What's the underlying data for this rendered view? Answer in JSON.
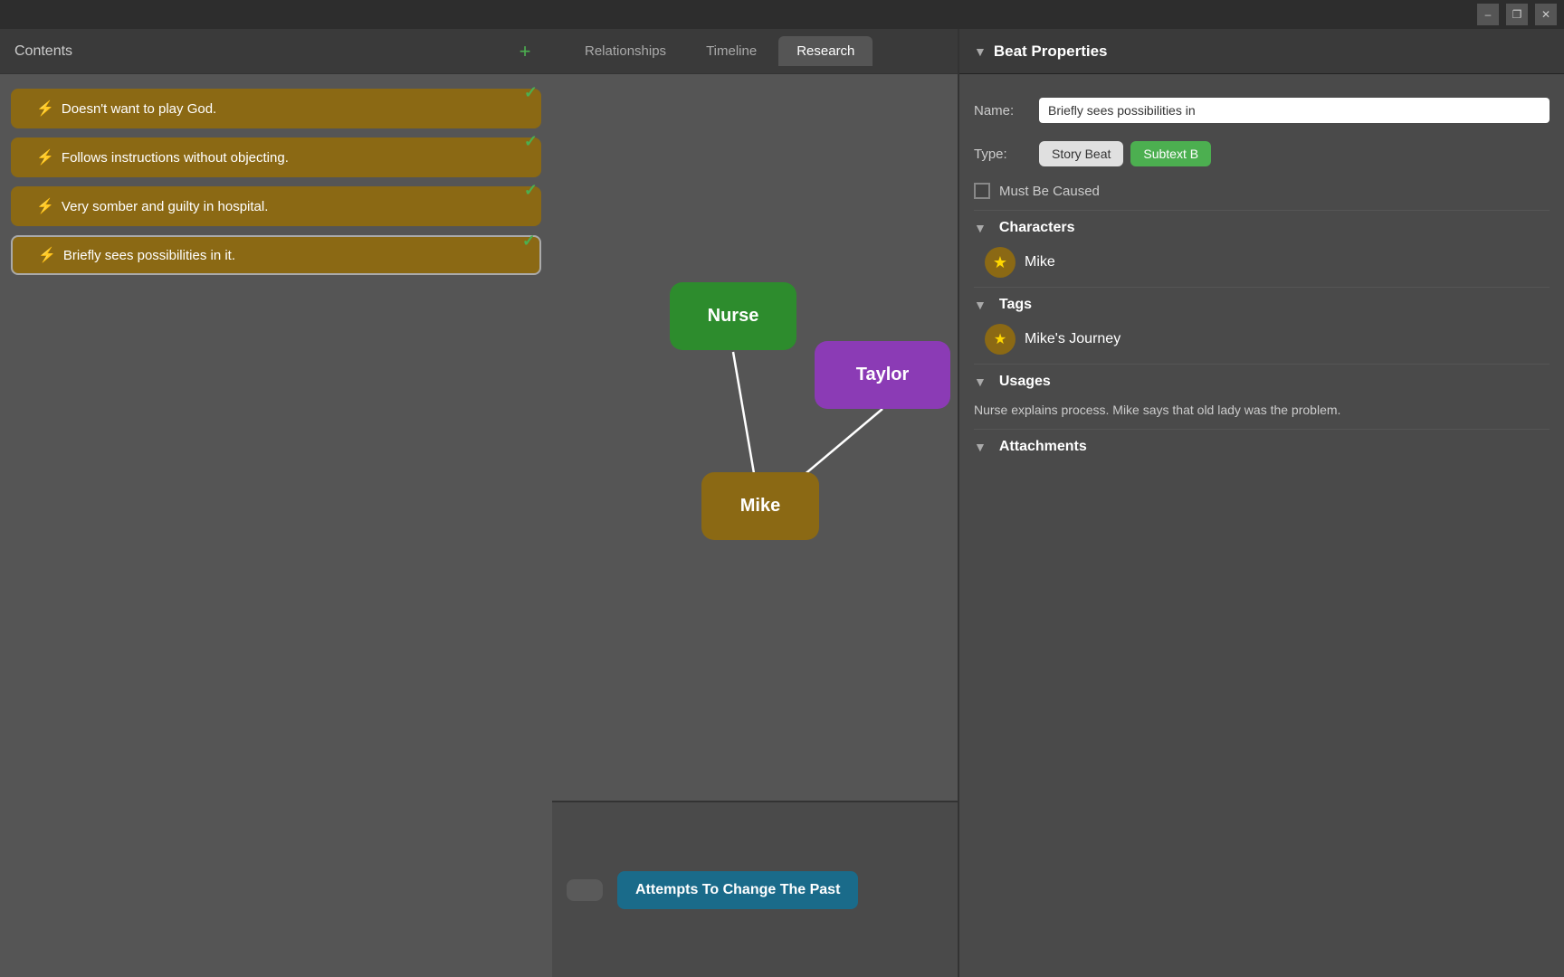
{
  "titlebar": {
    "minimize_label": "–",
    "restore_label": "❐",
    "close_label": "✕"
  },
  "left_panel": {
    "title": "Contents",
    "add_label": "+",
    "beats": [
      {
        "text": "Doesn't want to play God.",
        "checked": true,
        "selected": false
      },
      {
        "text": "Follows instructions without objecting.",
        "checked": true,
        "selected": false
      },
      {
        "text": "Very somber and guilty in hospital.",
        "checked": true,
        "selected": false
      },
      {
        "text": "Briefly sees possibilities in it.",
        "checked": true,
        "selected": true
      }
    ]
  },
  "center_panel": {
    "tabs": [
      {
        "label": "Relationships",
        "active": false
      },
      {
        "label": "Timeline",
        "active": false
      },
      {
        "label": "Research",
        "active": true
      }
    ],
    "nodes": [
      {
        "id": "nurse",
        "label": "Nurse",
        "color": "#2d8c2d"
      },
      {
        "id": "taylor",
        "label": "Taylor",
        "color": "#8b3bb5"
      },
      {
        "id": "mike",
        "label": "Mike",
        "color": "#8B6914"
      }
    ]
  },
  "bottom_strip": {
    "cards": [
      {
        "label": "Attempts To Change The Past",
        "color": "#1a6b8a"
      }
    ]
  },
  "right_panel": {
    "header": "Beat Properties",
    "name_label": "Name:",
    "name_value": "Briefly sees possibilities in",
    "type_label": "Type:",
    "type_story": "Story Beat",
    "type_subtext": "Subtext B",
    "must_be_caused_label": "Must Be Caused",
    "sections": {
      "characters": {
        "title": "Characters",
        "items": [
          {
            "name": "Mike",
            "star": "★"
          }
        ]
      },
      "tags": {
        "title": "Tags",
        "items": [
          {
            "name": "Mike's Journey",
            "star": "★"
          }
        ]
      },
      "usages": {
        "title": "Usages",
        "text": "Nurse explains process. Mike says that old lady was the problem."
      },
      "attachments": {
        "title": "Attachments"
      }
    }
  }
}
